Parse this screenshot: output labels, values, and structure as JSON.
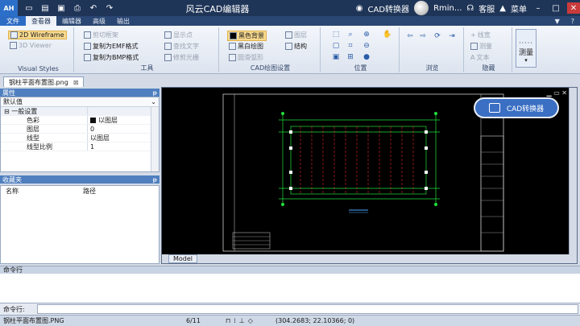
{
  "app": {
    "title": "风云CAD编辑器",
    "user_name": "Rmin...",
    "converter_label": "CAD转换器",
    "service_label": "客服",
    "menu_label": "菜单"
  },
  "tabs": [
    {
      "label": "文件"
    },
    {
      "label": "查看器"
    },
    {
      "label": "编辑器"
    },
    {
      "label": "高级"
    },
    {
      "label": "输出"
    }
  ],
  "ribbon": {
    "visual_styles": {
      "label": "Visual Styles",
      "wireframe": "2D Wireframe",
      "viewer3d": "3D Viewer"
    },
    "tools": {
      "label": "工具",
      "clip": "剪切框架",
      "copy_emf": "复制为EMF格式",
      "copy_bmp": "复制为BMP格式",
      "show_points": "显示点",
      "find_text": "查找文字",
      "fix_raster": "修剪光栅"
    },
    "cad_settings": {
      "label": "CAD绘图设置",
      "black_bg": "黑色背景",
      "bw_draw": "黑白绘图",
      "smooth_arc": "圆滑弧形",
      "layers": "图层",
      "structure": "结构"
    },
    "position": {
      "label": "位置"
    },
    "browse": {
      "label": "浏览"
    },
    "hide": {
      "label": "隐藏",
      "line_width": "线宽",
      "measure": "测量",
      "text": "文本"
    },
    "measure_big": "测量"
  },
  "document": {
    "tab_label": "钢柱平面布置图.png"
  },
  "properties": {
    "header": "属性",
    "combo_value": "默认值",
    "rows": [
      {
        "key": "一般设置",
        "value": "",
        "category": true
      },
      {
        "key": "色彩",
        "value": "以图层",
        "swatch": true
      },
      {
        "key": "图层",
        "value": "0"
      },
      {
        "key": "线型",
        "value": "以图层"
      },
      {
        "key": "线型比例",
        "value": "1"
      }
    ]
  },
  "favorites": {
    "header": "收藏夹",
    "col_name": "名称",
    "col_path": "路径"
  },
  "drawing": {
    "model_tab": "Model"
  },
  "command": {
    "header": "命令行",
    "input_label": "命令行:",
    "input_value": ""
  },
  "status": {
    "file": "钢柱平面布置图.PNG",
    "page": "6/11",
    "coords": "(304.2683; 22.10366; 0)"
  },
  "colors": {
    "title_bar": "#1f3558",
    "accent": "#2d6cc5",
    "drawing_bg": "#000000",
    "cad_green": "#22e03a",
    "cad_red": "#e02a2a"
  }
}
